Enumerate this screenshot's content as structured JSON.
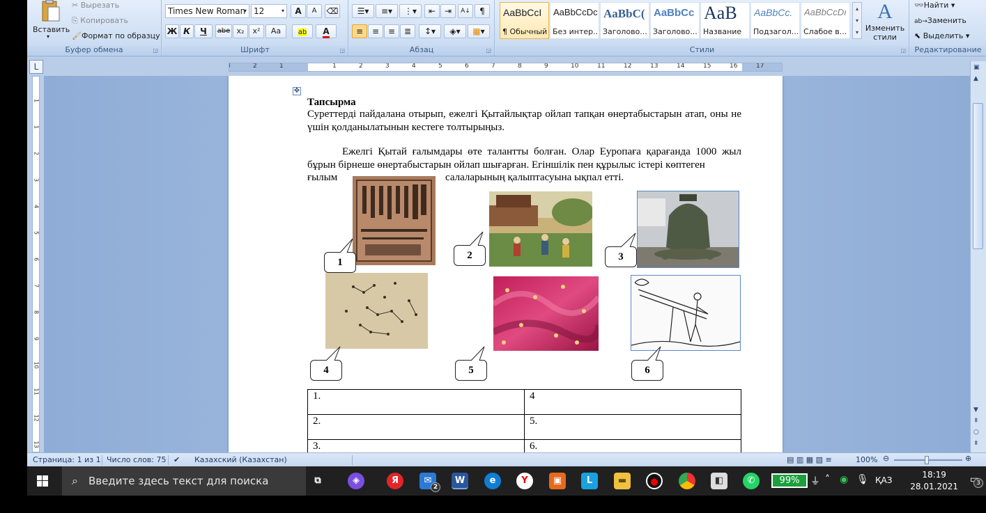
{
  "ribbon": {
    "clipboard": {
      "paste": "Вставить",
      "cut": "Вырезать",
      "copy": "Копировать",
      "format_painter": "Формат по образцу",
      "label": "Буфер обмена"
    },
    "font": {
      "name": "Times New Roman",
      "size": "12",
      "label": "Шрифт",
      "bold": "Ж",
      "italic": "К",
      "underline": "Ч",
      "strike": "abe",
      "sub": "x₂",
      "sup": "x²",
      "case": "Aa",
      "grow": "A",
      "shrink": "A"
    },
    "paragraph": {
      "label": "Абзац"
    },
    "styles": {
      "label": "Стили",
      "tiles": [
        {
          "sample": "AaBbCcI",
          "name": "¶ Обычный"
        },
        {
          "sample": "AaBbCcDc",
          "name": "Без интер..."
        },
        {
          "sample": "AaBbC(",
          "name": "Заголово..."
        },
        {
          "sample": "AaBbCc",
          "name": "Заголово..."
        },
        {
          "sample": "AaB",
          "name": "Название"
        },
        {
          "sample": "AaBbCc.",
          "name": "Подзагол..."
        },
        {
          "sample": "AaBbCcDı",
          "name": "Слабое в..."
        }
      ],
      "change_styles": "Изменить стили"
    },
    "editing": {
      "label": "Редактирование",
      "find": "Найти",
      "replace": "Заменить",
      "select": "Выделить"
    }
  },
  "ruler": {
    "numbers": [
      "3",
      "2",
      "1",
      "1",
      "2",
      "3",
      "4",
      "5",
      "6",
      "7",
      "8",
      "9",
      "10",
      "11",
      "12",
      "13",
      "14",
      "15",
      "16",
      "17"
    ]
  },
  "vruler": {
    "numbers": [
      "1",
      "1",
      "2",
      "3",
      "4",
      "5",
      "6",
      "7",
      "8",
      "9",
      "10",
      "11",
      "12",
      "13"
    ]
  },
  "document": {
    "heading": "Тапсырма",
    "instruction": "Суреттерді пайдалана отырып, ежелгі Қытайлықтар ойлап тапқан өнертабыстарын атап, оны не үшін қолданылатынын кестеге толтырыңыз.",
    "para1": "Ежелгі Қытай ғалымдары өте талантты болған. Олар Еуропаға қарағанда 1000 жыл бұрын бірнеше өнертабыстарын ойлап шығарған. Егіншілік пен құрылыс істері көптеген",
    "para2_left": "ғылым",
    "para2_right": "салаларының қалыптасуына ықпал етті.",
    "callouts": [
      "1",
      "2",
      "3",
      "4",
      "5",
      "6"
    ],
    "table": [
      [
        "1.",
        "4"
      ],
      [
        "2.",
        "5."
      ],
      [
        "3.",
        "6."
      ]
    ]
  },
  "status": {
    "page": "Страница: 1 из 1",
    "words": "Число слов: 75",
    "language": "Казахский (Казахстан)",
    "zoom": "100%"
  },
  "taskbar": {
    "search_placeholder": "Введите здесь текст для поиска",
    "mail_badge": "2",
    "battery": "99%",
    "lang": "ҚАЗ",
    "time": "18:19",
    "date": "28.01.2021",
    "notif_count": "3"
  }
}
